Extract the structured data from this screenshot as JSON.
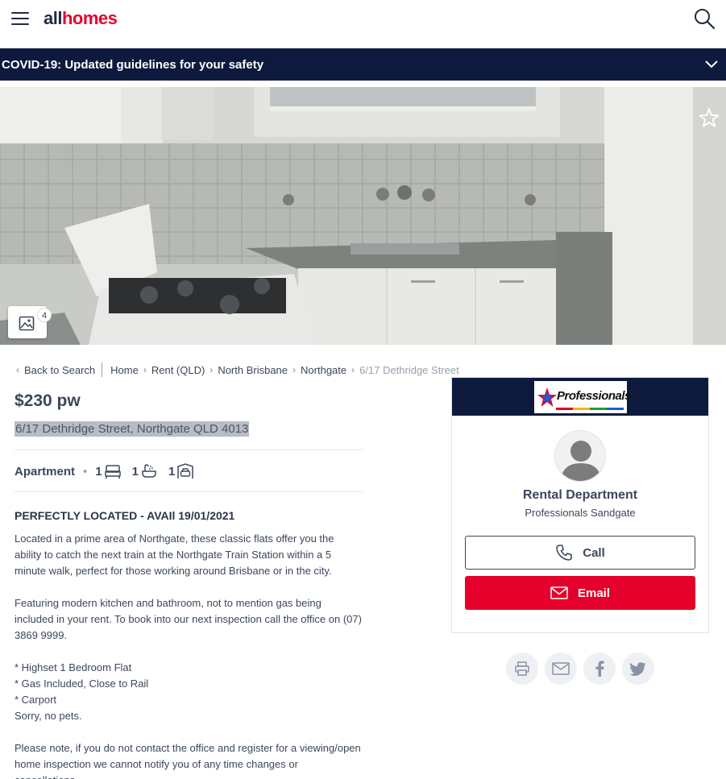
{
  "header": {
    "logo_all": "all",
    "logo_homes": "homes",
    "menu_icon": "hamburger-menu-icon",
    "search_icon": "search-icon"
  },
  "covid_banner": {
    "text": "COVID-19: Updated guidelines for your safety",
    "icon": "chevron-down-icon"
  },
  "gallery": {
    "count": "4",
    "icon": "image-gallery-icon",
    "favourite_icon": "star-outline-icon"
  },
  "breadcrumb": {
    "back": "Back to Search",
    "items": [
      "Home",
      "Rent (QLD)",
      "North Brisbane",
      "Northgate"
    ],
    "current": "6/17 Dethridge Street"
  },
  "listing": {
    "price": "$230 pw",
    "address": "6/17 Dethridge Street, Northgate QLD 4013",
    "property_type": "Apartment",
    "bedrooms": "1",
    "bathrooms": "1",
    "parking": "1",
    "headline": "PERFECTLY LOCATED - AVAIl 19/01/2021",
    "description": [
      "Located in a prime area of Northgate, these classic flats offer you the ability to catch the next train at the Northgate Train Station within a 5 minute walk, perfect for those working around Brisbane or in the city.",
      "Featuring modern kitchen and bathroom, not to mention gas being included in your rent. To book into our next inspection call the office on (07) 3869 9999.",
      "* Highset 1 Bedroom Flat\n* Gas Included, Close to Rail\n* Carport\nSorry, no pets.",
      "Please note, if you do not contact the office and register for a viewing/open home inspection we cannot notify you of any time changes or cancellations."
    ]
  },
  "agent": {
    "agency_logo_text": "Professionals",
    "name": "Rental Department",
    "agency": "Professionals Sandgate",
    "call_label": "Call",
    "email_label": "Email"
  },
  "share_icons": [
    "print-icon",
    "email-share-icon",
    "facebook-icon",
    "twitter-icon"
  ],
  "colors": {
    "brand_red": "#e4002b",
    "navy": "#0e1a3d",
    "text": "#3c475b"
  }
}
